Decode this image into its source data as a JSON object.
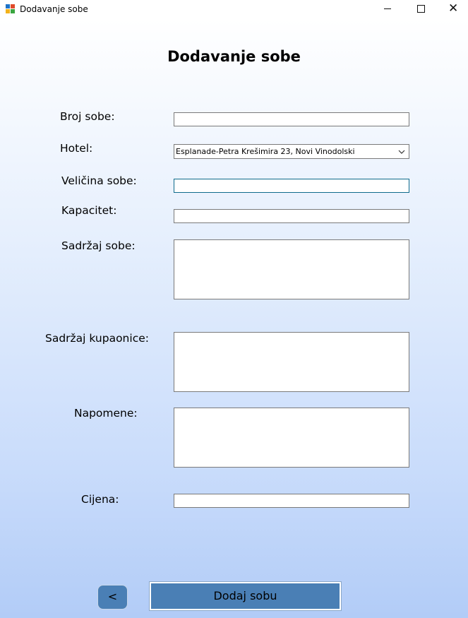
{
  "window": {
    "title": "Dodavanje sobe",
    "minimize_glyph": "—",
    "maximize_glyph": "☐",
    "close_glyph": "✕"
  },
  "form": {
    "heading": "Dodavanje sobe",
    "labels": {
      "room_number": "Broj sobe:",
      "hotel": "Hotel:",
      "room_size": "Veličina sobe:",
      "capacity": "Kapacitet:",
      "room_contents": "Sadržaj sobe:",
      "bathroom_contents": "Sadržaj kupaonice:",
      "notes": "Napomene:",
      "price": "Cijena:"
    },
    "values": {
      "room_number": "",
      "hotel": "Esplanade-Petra Krešimira 23, Novi Vinodolski",
      "room_size": "",
      "capacity": "",
      "room_contents": "",
      "bathroom_contents": "",
      "notes": "",
      "price": ""
    },
    "buttons": {
      "back": "<",
      "submit": "Dodaj sobu"
    }
  },
  "colors": {
    "button_bg": "#4a7fb5",
    "focus_border": "#0f6b8c"
  },
  "icons": {
    "app": "app-icon",
    "dropdown": "chevron-down-icon"
  }
}
